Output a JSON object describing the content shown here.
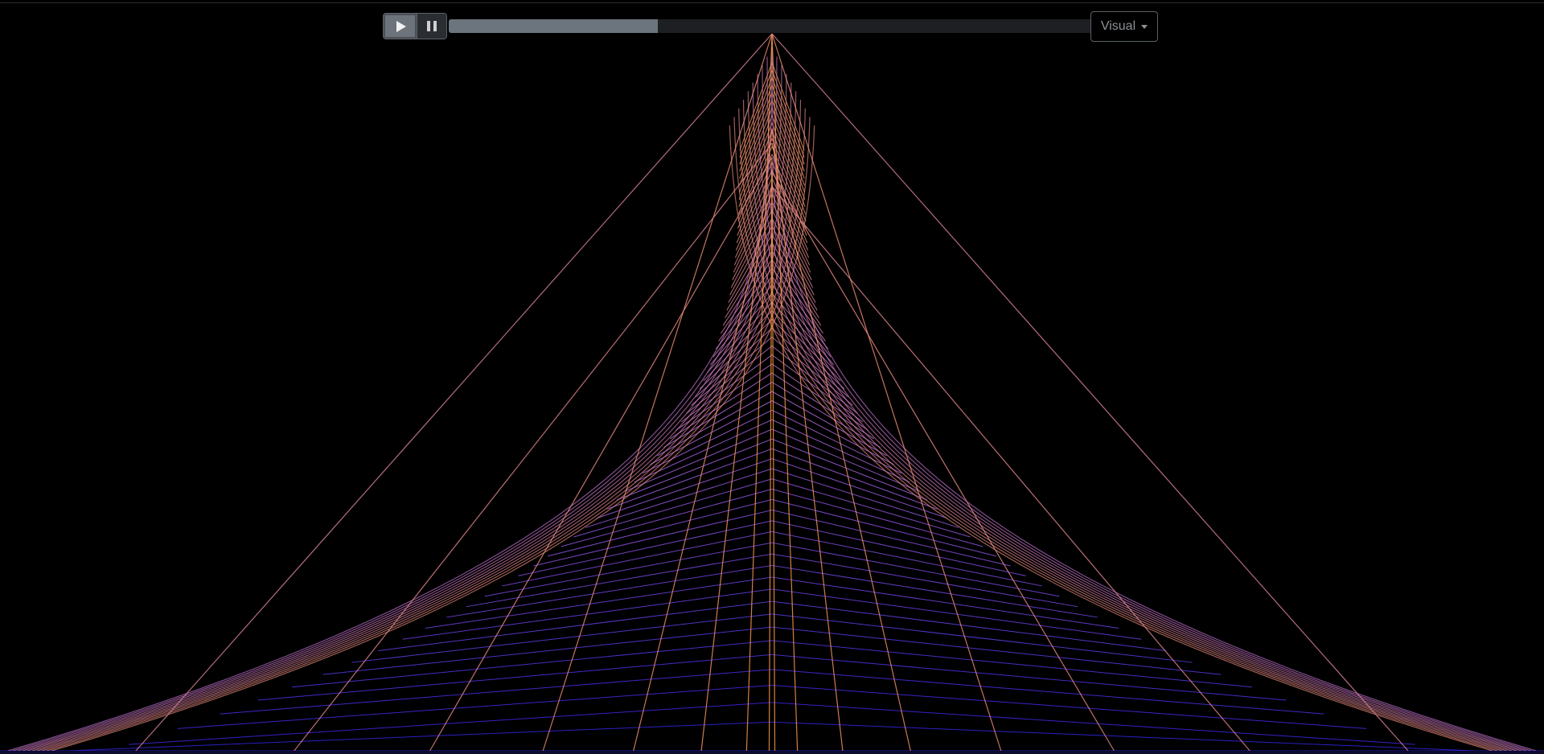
{
  "player": {
    "progress_fraction": 0.325,
    "visual_menu_label": "Visual"
  },
  "icons": {
    "play": "play-icon",
    "pause": "pause-icon",
    "caret": "chevron-down-icon"
  },
  "visualization": {
    "description_type": "audio-visualizer-line-mesh",
    "colors": {
      "peak": "#ff9b3c",
      "mid": "#b46adc",
      "base": "#2a1ee6",
      "background": "#000000"
    },
    "mesh_lines": 70,
    "ray_lines": 16
  }
}
